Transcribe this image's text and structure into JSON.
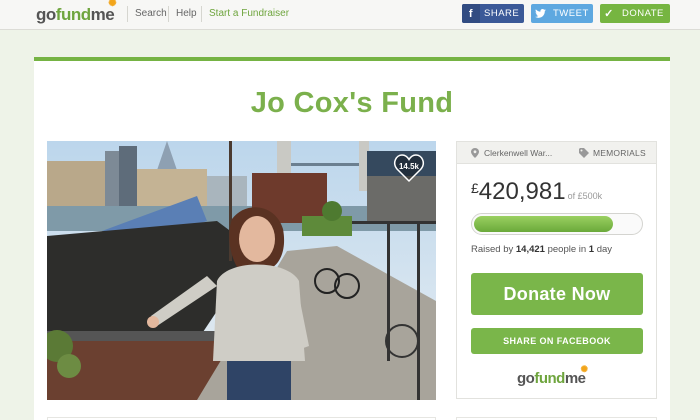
{
  "nav": {
    "logo": {
      "go": "go",
      "fund": "fund",
      "me": "me"
    },
    "links": [
      "Search",
      "Help",
      "Start a Fundraiser"
    ],
    "share_facebook": "SHARE",
    "tweet": "TWEET",
    "donate": "DONATE"
  },
  "campaign": {
    "title": "Jo Cox's Fund",
    "likes_badge": "14.5k",
    "location": "Clerkenwell War...",
    "category": "MEMORIALS",
    "currency": "£",
    "raised_amount": "420,981",
    "goal_text": "of £500k",
    "progress_fraction": 0.84,
    "raised_by_prefix": "Raised by",
    "people_count": "14,421",
    "people_in": "people in",
    "days_count": "1",
    "days_unit": "day",
    "donate_button": "Donate Now",
    "share_button": "SHARE ON FACEBOOK"
  },
  "colors": {
    "brand_green": "#75b343",
    "facebook_blue": "#3b5998",
    "twitter_blue": "#5ea8e0"
  },
  "icons": [
    "facebook-icon",
    "twitter-icon",
    "check-icon",
    "heart-icon",
    "location-pin-icon",
    "tag-icon",
    "sun-icon"
  ]
}
